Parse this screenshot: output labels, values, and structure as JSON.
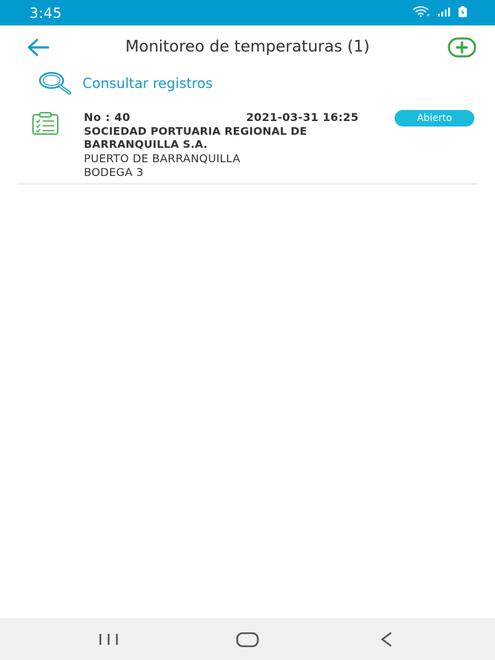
{
  "status_bar": {
    "time": "3:45",
    "icons": [
      "wifi-icon",
      "signal-icon",
      "battery-icon"
    ],
    "color": "#039bcf"
  },
  "app_bar": {
    "title": "Monitoreo de temperaturas (1)",
    "back_icon": "arrow-left-icon",
    "add_icon": "add-circle-icon",
    "accent": "#1a9ac9",
    "add_color": "#3da546"
  },
  "query": {
    "label": "Consultar registros",
    "icon": "magnifier-icon"
  },
  "records": [
    {
      "number": "No : 40",
      "datetime": "2021-03-31 16:25",
      "status": "Abierto",
      "status_color": "#1bbcd9",
      "company": "SOCIEDAD PORTUARIA REGIONAL DE BARRANQUILLA S.A.",
      "port": "PUERTO DE BARRANQUILLA",
      "area": "BODEGA 3",
      "icon": "clipboard-checklist-icon"
    }
  ],
  "nav_bar": {
    "buttons": [
      "recent-apps-icon",
      "home-icon",
      "back-icon"
    ]
  }
}
